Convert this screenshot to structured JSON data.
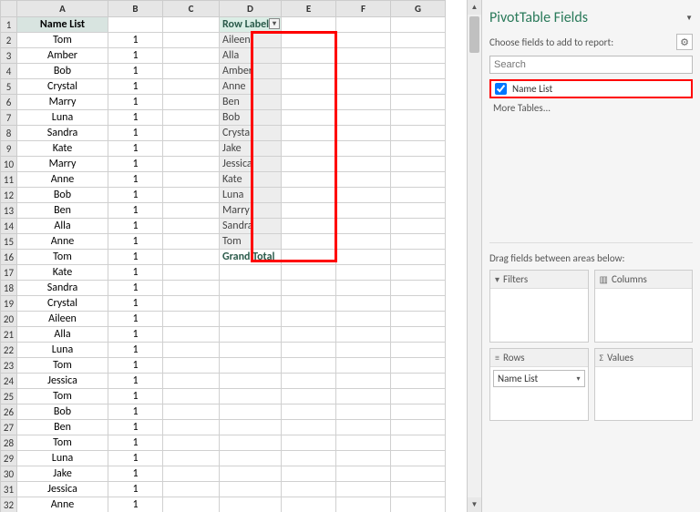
{
  "columns": [
    "A",
    "B",
    "C",
    "D",
    "E",
    "F",
    "G"
  ],
  "header_a": "Name List",
  "names": [
    "Tom",
    "Amber",
    "Bob",
    "Crystal",
    "Marry",
    "Luna",
    "Sandra",
    "Kate",
    "Marry",
    "Anne",
    "Bob",
    "Ben",
    "Alla",
    "Anne",
    "Tom",
    "Kate",
    "Sandra",
    "Crystal",
    "Aileen",
    "Alla",
    "Luna",
    "Tom",
    "Jessica",
    "Tom",
    "Bob",
    "Ben",
    "Tom",
    "Luna",
    "Jake",
    "Jessica",
    "Anne"
  ],
  "value_col": "1",
  "pivot": {
    "header": "Row Labels",
    "rows": [
      "Aileen",
      "Alla",
      "Amber",
      "Anne",
      "Ben",
      "Bob",
      "Crystal",
      "Jake",
      "Jessica",
      "Kate",
      "Luna",
      "Marry",
      "Sandra",
      "Tom"
    ],
    "grand_total": "Grand Total"
  },
  "panel": {
    "title": "PivotTable Fields",
    "subtitle": "Choose fields to add to report:",
    "search_placeholder": "Search",
    "field_name": "Name List",
    "more_tables": "More Tables...",
    "areas_label": "Drag fields between areas below:",
    "filters": "Filters",
    "columns_area": "Columns",
    "rows_area": "Rows",
    "values_area": "Values",
    "row_field_chip": "Name List"
  }
}
